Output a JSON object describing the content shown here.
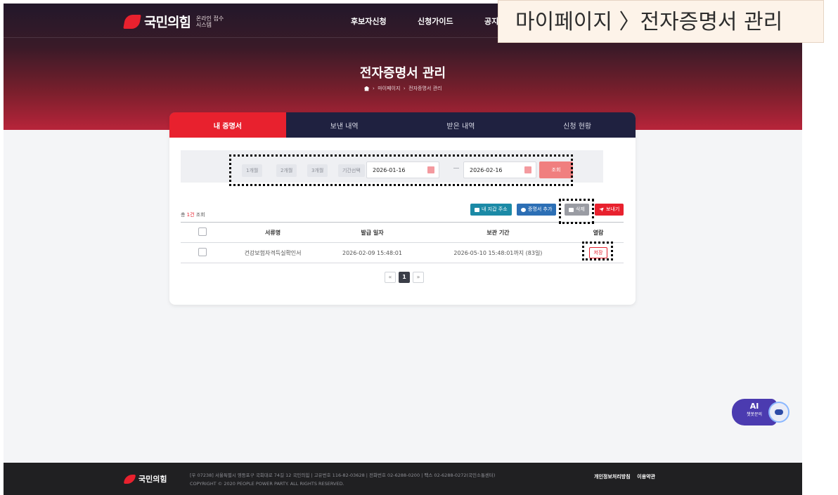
{
  "header": {
    "logo_text": "국민의힘",
    "logo_sub_1": "온라인 접수",
    "logo_sub_2": "시스템",
    "nav": [
      "후보자신청",
      "신청가이드",
      "공지"
    ]
  },
  "hero": {
    "title": "전자증명서 관리",
    "breadcrumb": [
      "마이페이지",
      "전자증명서 관리"
    ]
  },
  "overlay_banner": "마이페이지 〉전자증명서 관리",
  "tabs": [
    {
      "label": "내 증명서",
      "active": true
    },
    {
      "label": "보낸 내역",
      "active": false
    },
    {
      "label": "받은 내역",
      "active": false
    },
    {
      "label": "신청 현황",
      "active": false
    }
  ],
  "filter": {
    "periods": [
      "1개월",
      "2개월",
      "3개월",
      "기간선택"
    ],
    "start_date": "2026-01-16",
    "end_date": "2026-02-16",
    "search_label": "조회"
  },
  "result": {
    "prefix": "총 ",
    "count": "1건",
    "suffix": " 조회"
  },
  "actions": {
    "wallet": "내 지갑 주소",
    "add": "증명서 추가",
    "delete": "삭제",
    "send": "보내기"
  },
  "table": {
    "headers": [
      "서류명",
      "발급 일자",
      "보관 기간",
      "열람"
    ],
    "rows": [
      {
        "name": "건강보험자격득실확인서",
        "issued": "2026-02-09 15:48:01",
        "retention": "2026-05-10 15:48:01까지 (83일)",
        "view": "저장"
      }
    ]
  },
  "pagination": {
    "prev": "«",
    "current": "1",
    "next": "»"
  },
  "ai_chat": {
    "title": "AI",
    "sub": "챗봇문의"
  },
  "footer": {
    "logo_text": "국민의힘",
    "line1": "[우 07238] 서울특별시 영등포구 국회대로 74길 12 국민의힘 | 고유번호 116-82-03628 | 전화번호 02-6288-0200 | 팩스 02-6288-0272(국민소통센터)",
    "line2": "COPYRIGHT © 2020 PEOPLE POWER PARTY. ALL RIGHTS RESERVED.",
    "link_privacy": "개인정보처리방침",
    "link_terms": "이용약관"
  },
  "colors": {
    "brand_red": "#e8212e",
    "navy": "#1f2140",
    "teal": "#1b8aa6",
    "blue": "#2c6fb5"
  }
}
